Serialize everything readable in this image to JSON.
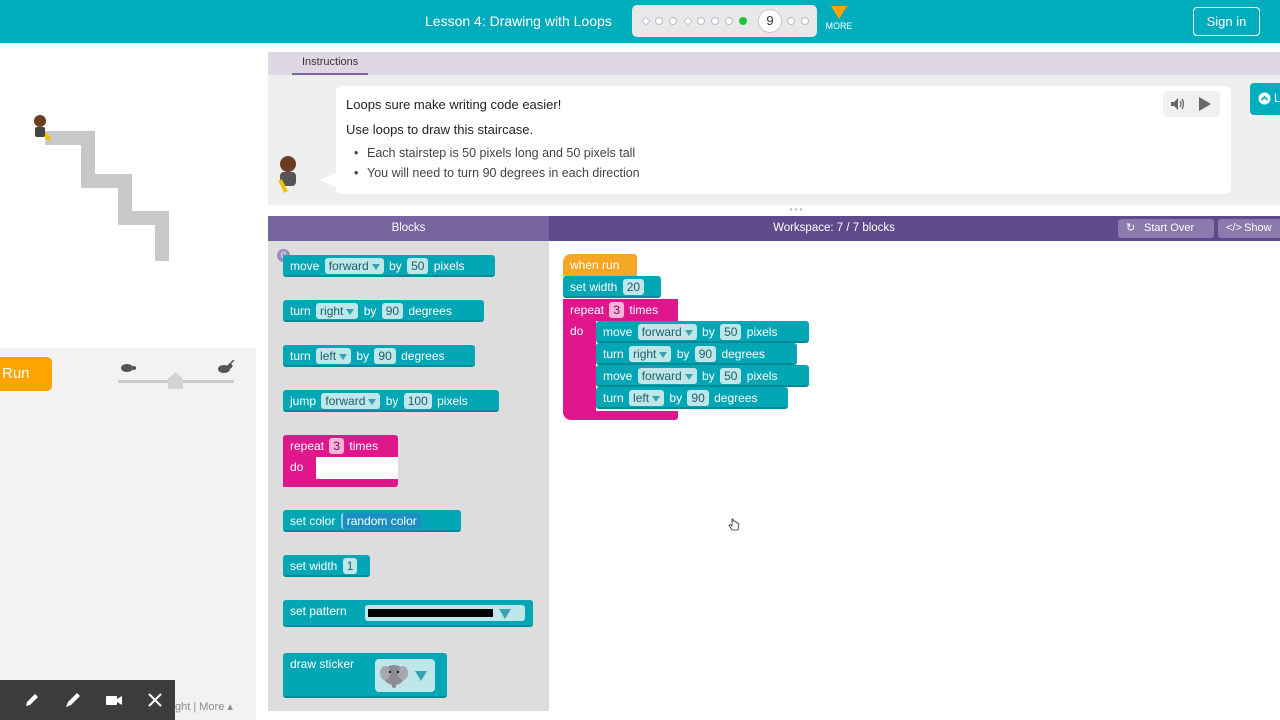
{
  "header": {
    "lesson_title": "Lesson 4: Drawing with Loops",
    "current_level": "9",
    "more_label": "MORE",
    "sign_in_label": "Sign in"
  },
  "visualization": {
    "run_label": "Run",
    "footer_links": "ght  |  More ▴"
  },
  "instructions": {
    "tab_label": "Instructions",
    "line1": "Loops sure make writing code easier!",
    "line2": "Use loops to draw this staircase.",
    "bullets": [
      "Each stairstep is 50 pixels long and 50 pixels tall",
      "You will need to turn 90 degrees in each direction"
    ],
    "side_button_label": "L"
  },
  "panels": {
    "blocks_header": "Blocks",
    "workspace_header": "Workspace: 7 / 7 blocks",
    "start_over_label": "Start Over",
    "show_code_label": "Show"
  },
  "toolbox": {
    "badge": "0",
    "move": {
      "word": "move",
      "dir": "forward",
      "by": "by",
      "value": "50",
      "unit": "pixels"
    },
    "turn_right": {
      "word": "turn",
      "dir": "right",
      "by": "by",
      "value": "90",
      "unit": "degrees"
    },
    "turn_left": {
      "word": "turn",
      "dir": "left",
      "by": "by",
      "value": "90",
      "unit": "degrees"
    },
    "jump": {
      "word": "jump",
      "dir": "forward",
      "by": "by",
      "value": "100",
      "unit": "pixels"
    },
    "repeat": {
      "word": "repeat",
      "value": "3",
      "unit": "times",
      "do": "do"
    },
    "set_color": {
      "word": "set color",
      "value": "random color"
    },
    "set_width": {
      "word": "set width",
      "value": "1"
    },
    "set_pattern": {
      "word": "set pattern"
    },
    "draw_sticker": {
      "word": "draw sticker"
    }
  },
  "program": {
    "when_run": "when run",
    "set_width": {
      "word": "set width",
      "value": "20"
    },
    "repeat": {
      "word": "repeat",
      "value": "3",
      "unit": "times",
      "do": "do"
    },
    "body": [
      {
        "word": "move",
        "dir": "forward",
        "by": "by",
        "value": "50",
        "unit": "pixels"
      },
      {
        "word": "turn",
        "dir": "right",
        "by": "by",
        "value": "90",
        "unit": "degrees"
      },
      {
        "word": "move",
        "dir": "forward",
        "by": "by",
        "value": "50",
        "unit": "pixels"
      },
      {
        "word": "turn",
        "dir": "left",
        "by": "by",
        "value": "90",
        "unit": "degrees"
      }
    ]
  },
  "colors": {
    "header": "#00adbc",
    "run_button": "#ffa400",
    "teal_block": "#02a6b4",
    "pink_block": "#e0168d",
    "event_block": "#f5a623",
    "workspace_header": "#5f4b8b"
  }
}
